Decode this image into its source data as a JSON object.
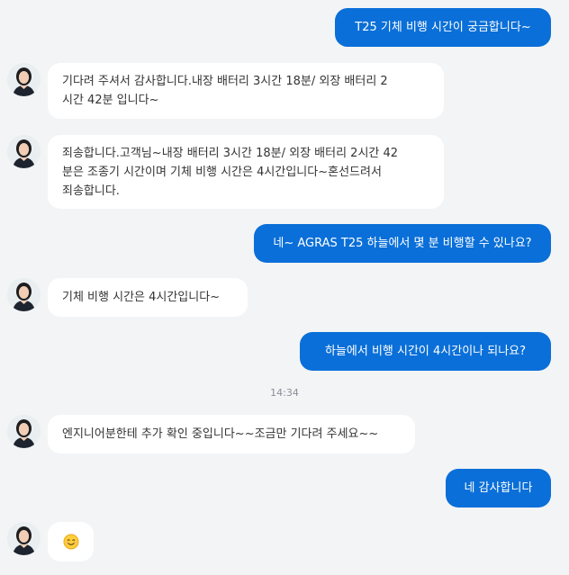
{
  "messages": [
    {
      "id": "m1",
      "type": "outgoing",
      "text": "T25 기체 비행 시간이 궁금합니다~"
    },
    {
      "id": "m2",
      "type": "incoming",
      "text": "기다려 주셔서 감사합니다.내장 배터리 3시간 18분/ 외장 배터리 2\n시간 42분 입니다~"
    },
    {
      "id": "m3",
      "type": "incoming",
      "text": "죄송합니다.고객님~내장 배터리 3시간 18분/ 외장 배터리 2시간 42\n분은 조종기 시간이며 기체 비행 시간은 4시간입니다~혼선드려서\n죄송합니다."
    },
    {
      "id": "m4",
      "type": "outgoing",
      "text": "네~ AGRAS T25 하늘에서 몇 분 비행할 수 있나요?"
    },
    {
      "id": "m5",
      "type": "incoming",
      "text": "기체 비행 시간은 4시간입니다~"
    },
    {
      "id": "m6",
      "type": "outgoing",
      "text": "하늘에서 비행 시간이 4시간이나 되나요?"
    },
    {
      "id": "m7",
      "type": "incoming",
      "text": "엔지니어분한테 추가 확인 중입니다~~조금만 기다려 주세요~~"
    },
    {
      "id": "m8",
      "type": "outgoing",
      "text": "네 감사합니다"
    },
    {
      "id": "m9",
      "type": "incoming",
      "emoji": "smiling-face"
    }
  ],
  "timestamp": "14:34",
  "colors": {
    "outgoing_bubble": "#0a6fd8",
    "incoming_bubble": "#ffffff",
    "background": "#f3f4f6",
    "timestamp_text": "#8a8f96"
  }
}
